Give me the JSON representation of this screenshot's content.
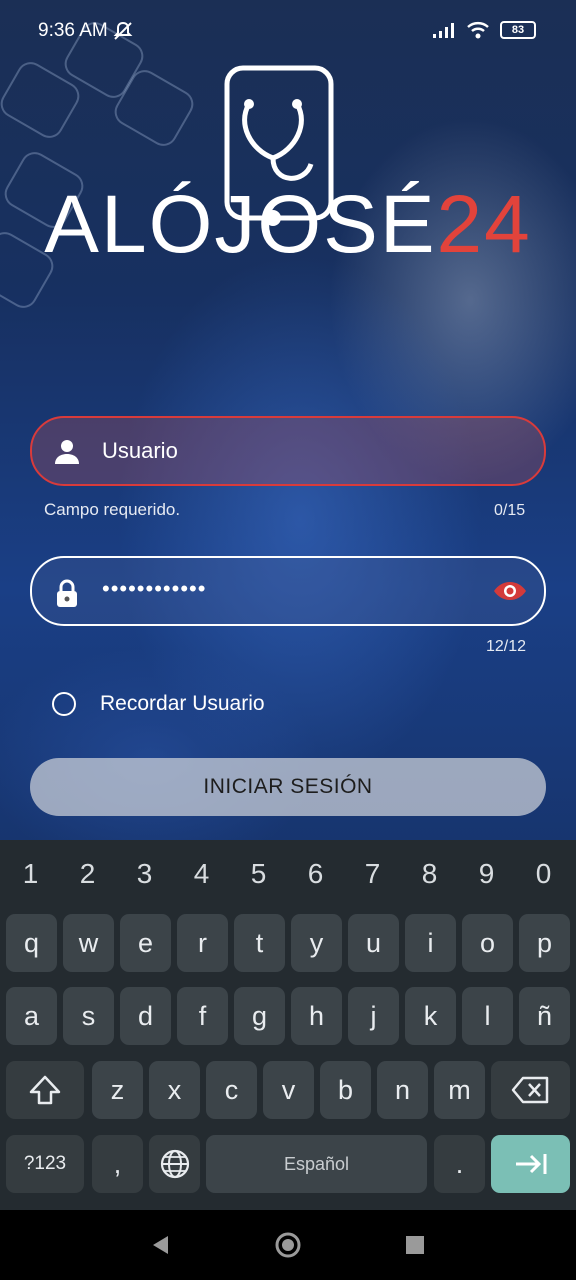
{
  "status": {
    "time": "9:36 AM",
    "battery": "83"
  },
  "brand": {
    "name_main": "ALÓJOSÉ",
    "name_accent": "24",
    "accent_color": "#e2433b"
  },
  "login": {
    "username": {
      "placeholder": "Usuario",
      "helper_error": "Campo requerido.",
      "counter": "0/15"
    },
    "password": {
      "value": "••••••••••••",
      "counter": "12/12"
    },
    "remember_label": "Recordar Usuario",
    "submit_label": "INICIAR SESIÓN"
  },
  "keyboard": {
    "numbers": [
      "1",
      "2",
      "3",
      "4",
      "5",
      "6",
      "7",
      "8",
      "9",
      "0"
    ],
    "row1": [
      "q",
      "w",
      "e",
      "r",
      "t",
      "y",
      "u",
      "i",
      "o",
      "p"
    ],
    "row2": [
      "a",
      "s",
      "d",
      "f",
      "g",
      "h",
      "j",
      "k",
      "l",
      "ñ"
    ],
    "row3": [
      "z",
      "x",
      "c",
      "v",
      "b",
      "n",
      "m"
    ],
    "symbols_label": "?123",
    "comma": ",",
    "space_label": "Español",
    "period": "."
  },
  "icons": {
    "status": [
      "notifications-off-icon",
      "signal-icon",
      "wifi-icon",
      "battery-icon"
    ],
    "fields": [
      "person-icon",
      "lock-icon",
      "eye-icon"
    ],
    "keyboard": [
      "shift-icon",
      "backspace-icon",
      "globe-icon",
      "tab-enter-icon"
    ],
    "nav": [
      "back-icon",
      "home-icon",
      "recents-icon"
    ]
  }
}
